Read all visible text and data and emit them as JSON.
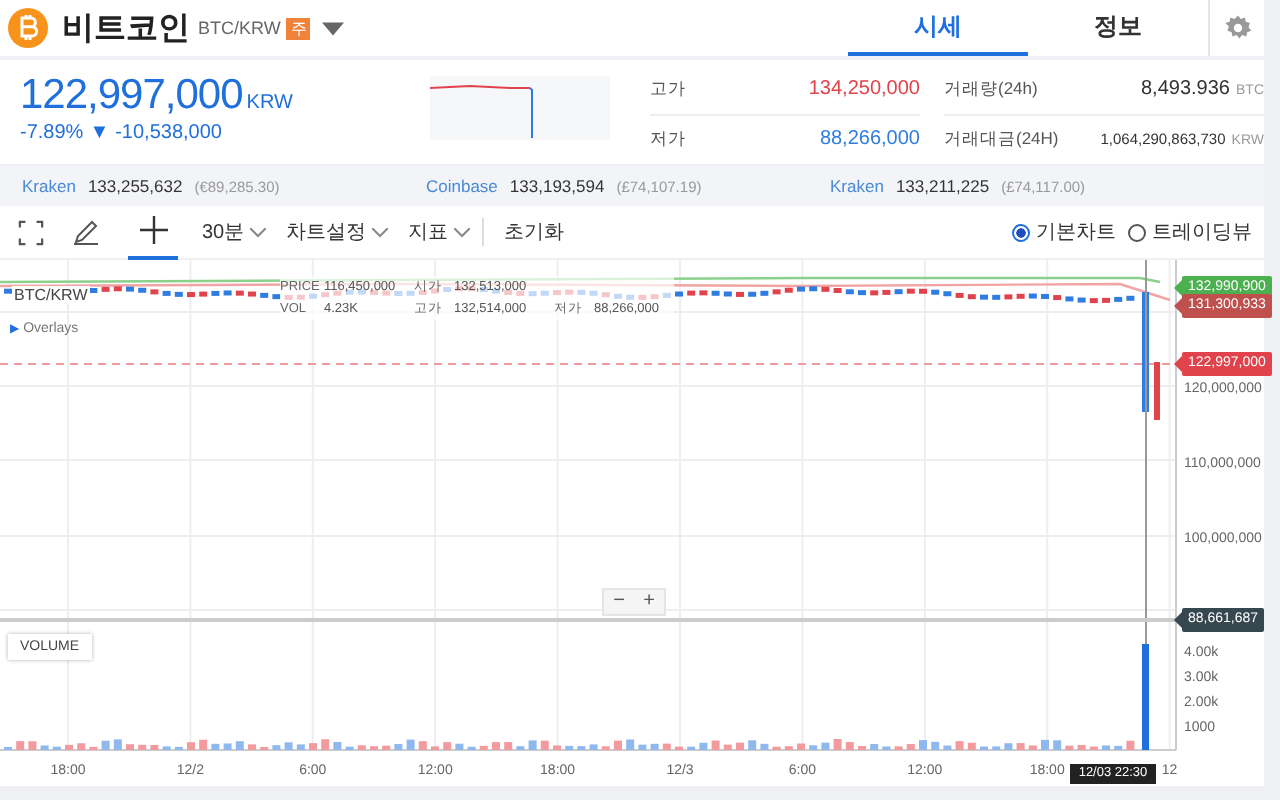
{
  "header": {
    "title": "비트코인",
    "pair": "BTC/KRW",
    "badge": "주"
  },
  "tabs": [
    {
      "label": "시세",
      "selected": true
    },
    {
      "label": "정보",
      "selected": false
    }
  ],
  "price": {
    "value": "122,997,000",
    "unit": "KRW",
    "change_percent": "-7.89%",
    "change_arrow": "▼",
    "change_amount": "-10,538,000"
  },
  "stats": [
    {
      "label": "고가",
      "value": "134,250,000",
      "kind": "up"
    },
    {
      "label": "거래량(24h)",
      "value": "8,493.936",
      "unit": "BTC",
      "kind": "plain"
    },
    {
      "label": "저가",
      "value": "88,266,000",
      "kind": "down"
    },
    {
      "label": "거래대금(24H)",
      "value": "1,064,290,863,730",
      "unit": "KRW",
      "kind": "small"
    }
  ],
  "exchanges": [
    {
      "name": "Kraken",
      "price": "133,255,632",
      "foreign": "(€89,285.30)"
    },
    {
      "name": "Coinbase",
      "price": "133,193,594",
      "foreign": "(£74,107.19)"
    },
    {
      "name": "Kraken",
      "price": "133,211,225",
      "foreign": "(£74,117.00)"
    }
  ],
  "toolbar": {
    "interval": "30분",
    "settings": "차트설정",
    "indicators": "지표",
    "reset": "초기화"
  },
  "chart_views": [
    {
      "label": "기본차트",
      "selected": true
    },
    {
      "label": "트레이딩뷰",
      "selected": false
    }
  ],
  "chart": {
    "symbol": "BTC/KRW",
    "legend": [
      [
        {
          "label": "PRICE",
          "value": "116,450,000"
        },
        {
          "label": "시가",
          "value": "132,513,000"
        }
      ],
      [
        {
          "label": "VOL",
          "value": "4.23K"
        },
        {
          "label": "고가",
          "value": "132,514,000"
        },
        {
          "label": "저가",
          "value": "88,266,000"
        }
      ]
    ],
    "overlays_label": "Overlays",
    "overlays_arrow": "▶",
    "price_ticks": [
      "120,000,000",
      "110,000,000",
      "100,000,000"
    ],
    "price_tags": [
      {
        "value": "132,990,900",
        "color": "#4caf50"
      },
      {
        "value": "131,300,933",
        "color": "#c0504d"
      },
      {
        "value": "122,997,000",
        "color": "#e0434b"
      },
      {
        "value": "88,661,687",
        "color": "#37474f"
      }
    ],
    "volume_label": "VOLUME",
    "volume_ticks": [
      "4.00k",
      "3.00k",
      "2.00k",
      "1000"
    ],
    "time_ticks": [
      "18:00",
      "12/2",
      "6:00",
      "12:00",
      "18:00",
      "12/3",
      "6:00",
      "12:00",
      "18:00",
      "12"
    ],
    "crosshair_time": "12/03 22:30",
    "zoom_out": "−",
    "zoom_in": "+"
  }
}
